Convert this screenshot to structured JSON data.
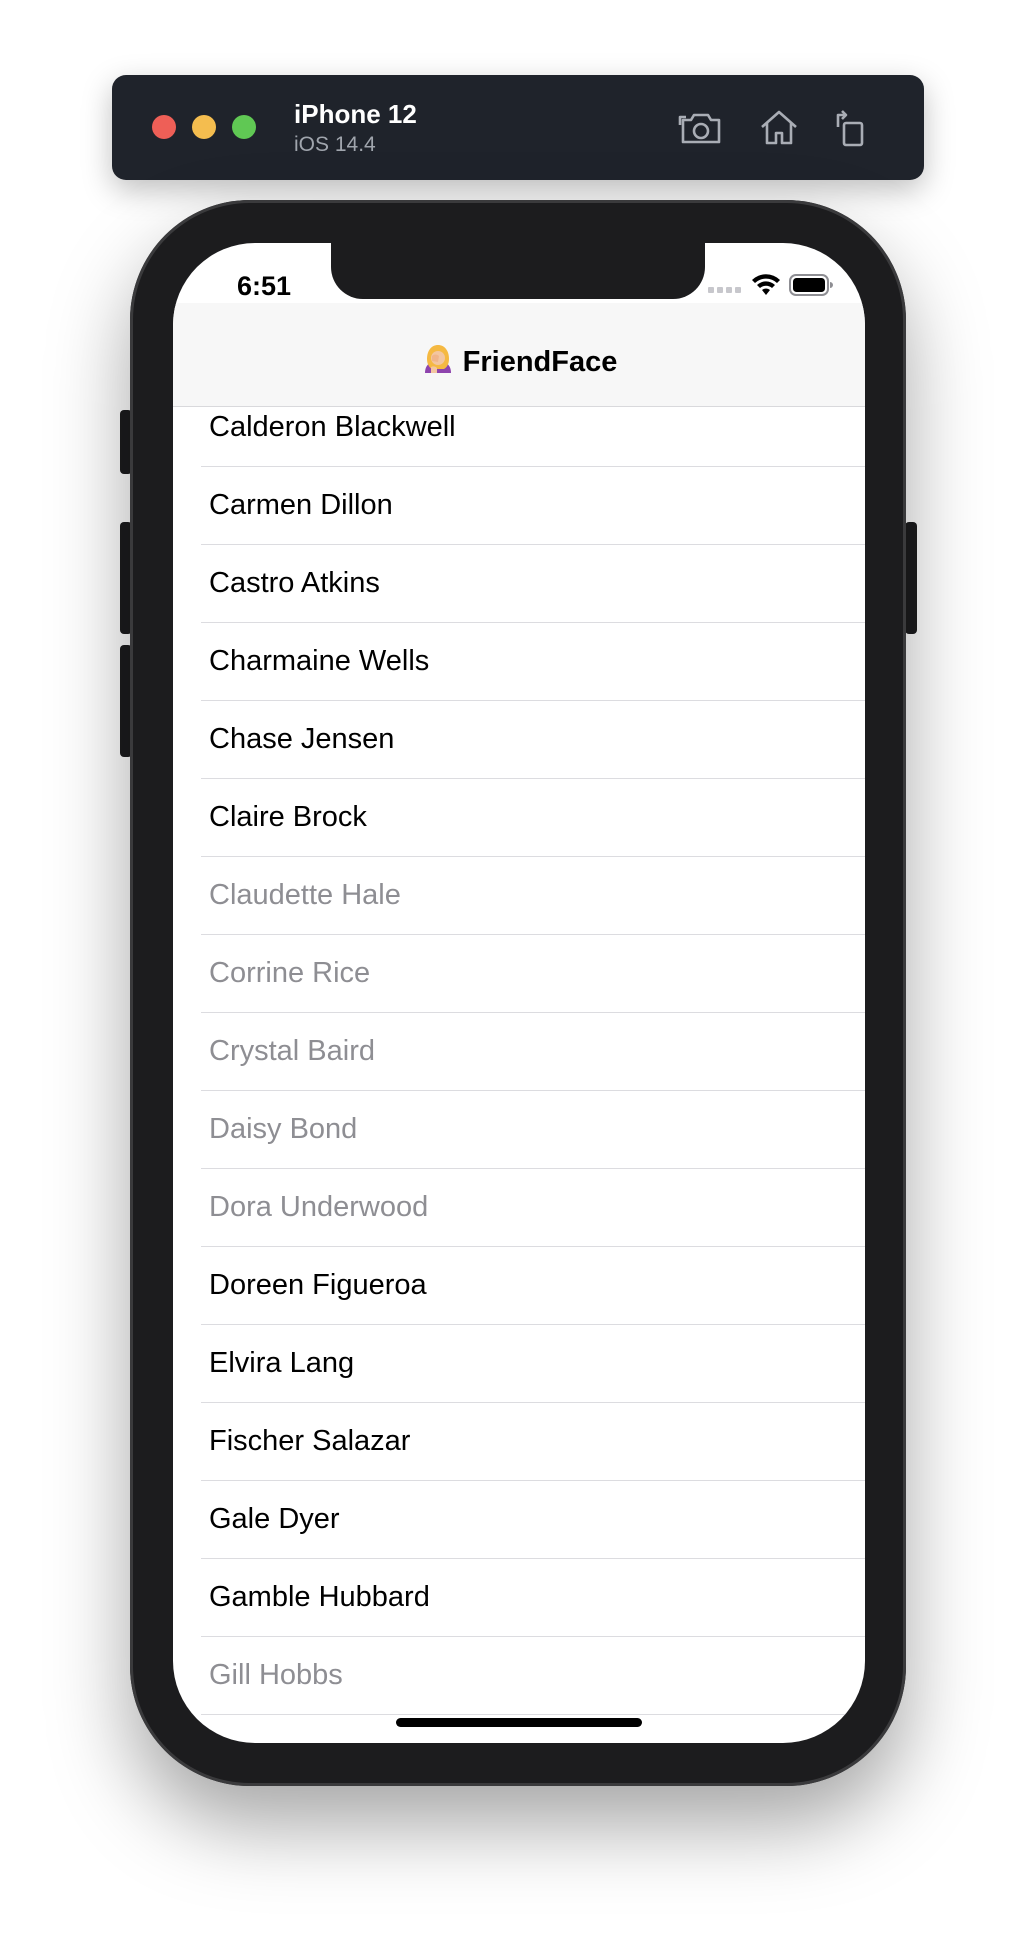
{
  "simulator": {
    "device_name": "iPhone 12",
    "os_version": "iOS 14.4",
    "icons": [
      "screenshot-icon",
      "home-icon",
      "rotate-icon"
    ]
  },
  "status_bar": {
    "time": "6:51",
    "icons": [
      "cellular-dots-icon",
      "wifi-icon",
      "battery-icon"
    ]
  },
  "navbar": {
    "emoji_icon": "woman-facepalming-emoji",
    "title": "FriendFace"
  },
  "colors": {
    "active_text": "#000000",
    "inactive_text": "#8e8e93",
    "navbar_bg": "#f7f7f7",
    "toolbar_bg": "#1f232b"
  },
  "friends": [
    {
      "name": "Calderon Blackwell",
      "active": true
    },
    {
      "name": "Carmen Dillon",
      "active": true
    },
    {
      "name": "Castro Atkins",
      "active": true
    },
    {
      "name": "Charmaine Wells",
      "active": true
    },
    {
      "name": "Chase Jensen",
      "active": true
    },
    {
      "name": "Claire Brock",
      "active": true
    },
    {
      "name": "Claudette Hale",
      "active": false
    },
    {
      "name": "Corrine Rice",
      "active": false
    },
    {
      "name": "Crystal Baird",
      "active": false
    },
    {
      "name": "Daisy Bond",
      "active": false
    },
    {
      "name": "Dora Underwood",
      "active": false
    },
    {
      "name": "Doreen Figueroa",
      "active": true
    },
    {
      "name": "Elvira Lang",
      "active": true
    },
    {
      "name": "Fischer Salazar",
      "active": true
    },
    {
      "name": "Gale Dyer",
      "active": true
    },
    {
      "name": "Gamble Hubbard",
      "active": true
    },
    {
      "name": "Gill Hobbs",
      "active": false
    }
  ]
}
